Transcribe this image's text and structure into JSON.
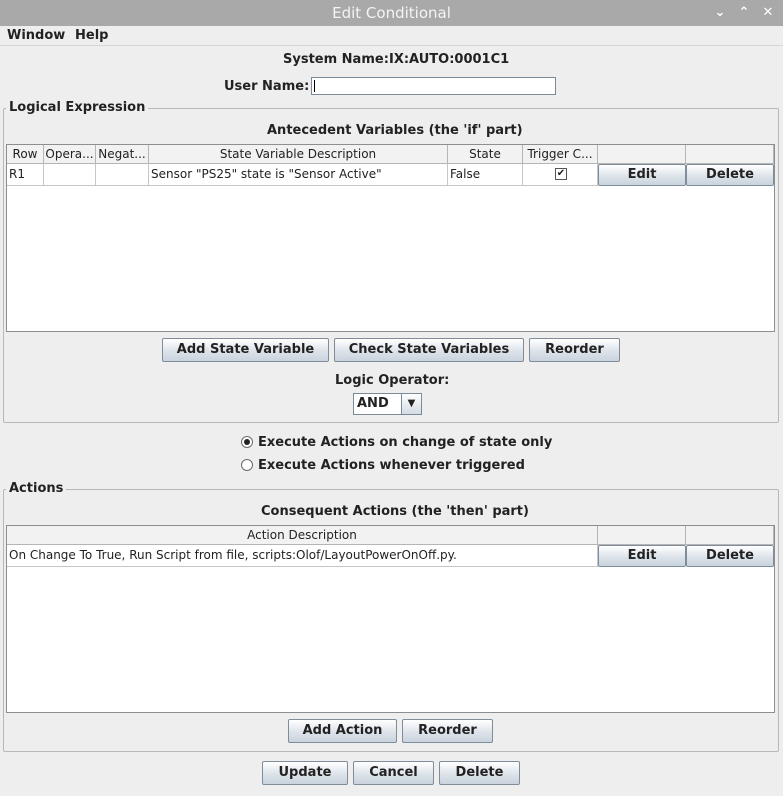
{
  "window": {
    "title": "Edit Conditional",
    "controls": {
      "minimize": "⌄",
      "maximize": "⌃",
      "close": "✕"
    }
  },
  "menu": {
    "items": [
      "Window",
      "Help"
    ]
  },
  "system_name": {
    "label": "System Name:",
    "value": "IX:AUTO:0001C1"
  },
  "user_name": {
    "label": "User Name:",
    "value": ""
  },
  "logical_expression": {
    "group_title": "Logical Expression",
    "table_title": "Antecedent Variables (the 'if' part)",
    "columns": [
      "Row",
      "Opera...",
      "Negat...",
      "State Variable Description",
      "State",
      "Trigger C...",
      "",
      ""
    ],
    "rows": [
      {
        "row": "R1",
        "operator": "",
        "negation": "",
        "description": "Sensor \"PS25\" state is \"Sensor Active\"",
        "state": "False",
        "trigger_checked": "✔",
        "edit": "Edit",
        "delete": "Delete"
      }
    ],
    "buttons": {
      "add": "Add State Variable",
      "check": "Check State Variables",
      "reorder": "Reorder"
    },
    "logic_operator": {
      "label": "Logic Operator:",
      "value": "AND",
      "arrow": "▼"
    }
  },
  "execute_options": [
    {
      "label": "Execute Actions on change of state only",
      "selected": true
    },
    {
      "label": "Execute Actions whenever triggered",
      "selected": false
    }
  ],
  "actions": {
    "group_title": "Actions",
    "table_title": "Consequent Actions (the 'then' part)",
    "columns": [
      "Action Description",
      "",
      ""
    ],
    "rows": [
      {
        "description": "On Change To True, Run Script from file, scripts:Olof/LayoutPowerOnOff.py.",
        "edit": "Edit",
        "delete": "Delete"
      }
    ],
    "buttons": {
      "add": "Add Action",
      "reorder": "Reorder"
    }
  },
  "footer": {
    "update": "Update",
    "cancel": "Cancel",
    "delete": "Delete"
  }
}
